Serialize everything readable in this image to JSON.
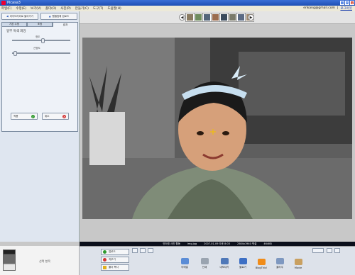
{
  "window": {
    "title": "Picasa3"
  },
  "menu": [
    "파일(F)",
    "수정(E)",
    "보기(V)",
    "폴더(O)",
    "사진(P)",
    "만들기(C)",
    "도구(T)",
    "도움말(H)"
  ],
  "account": {
    "email": "enkang@gmail.com",
    "sep": "|",
    "signout": "로그아웃"
  },
  "left": {
    "back_btn": "라이브러리로 돌아가기",
    "upload_btn": "웹앨범에 업로드",
    "tabs": [
      "기본 수정",
      "조정",
      "효과"
    ],
    "section_title": "일부 특색 화강",
    "slider1_label": "정도",
    "slider2_label": "선명도",
    "slider1_level": 0.53,
    "slider2_level": 0.05,
    "apply": "적용",
    "cancel": "취소"
  },
  "status": {
    "info": [
      "인터넷 사진 활동",
      "img.jpg",
      "2007-01-09 오후 8:03",
      "2584x1940 픽셀",
      "464KB"
    ]
  },
  "tray": {
    "held": "선택 항목",
    "btn1": "업로드",
    "btn2": "지우기",
    "btn3": "폴더 복사",
    "tools": [
      "이메일",
      "인쇄",
      "내보내기",
      "블로거",
      "BlogThis!",
      "콜라주",
      "Movie"
    ]
  },
  "colors": {
    "accent": "#1e4fb4",
    "ok": "#2f9a2f",
    "cancel": "#d33333"
  }
}
